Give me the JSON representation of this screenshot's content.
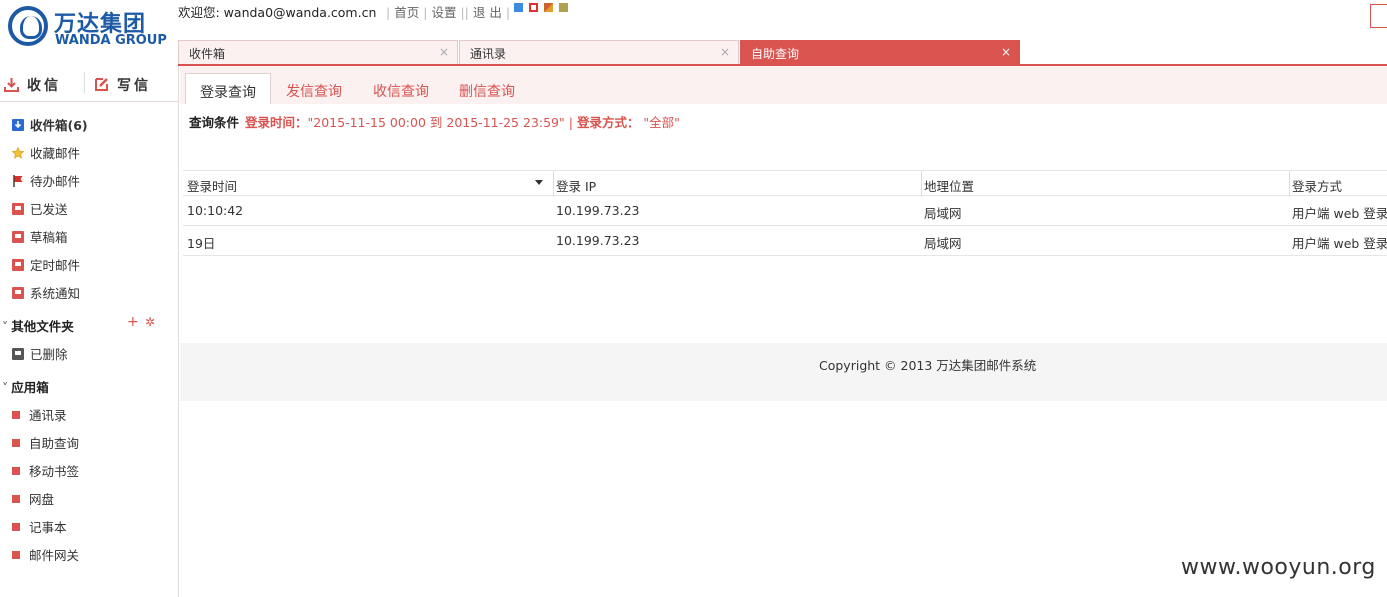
{
  "brand": {
    "name_cn": "万达集团",
    "name_en": "WANDA GROUP"
  },
  "header": {
    "welcome": "欢迎您: wanda0@wanda.com.cn",
    "links": [
      "首页",
      "设置",
      "退 出"
    ],
    "skins": [
      "#3b8be0",
      "#e03030",
      "#d06030",
      "#b0a050"
    ]
  },
  "tabs": [
    {
      "label": "收件箱",
      "close": "×"
    },
    {
      "label": "通讯录",
      "close": "×"
    },
    {
      "label": "自助查询",
      "close": "×"
    }
  ],
  "sidebar": {
    "receive": "收信",
    "write": "写信",
    "folders": [
      {
        "label": "收件箱(6)",
        "icon": "inbox-icon"
      },
      {
        "label": "收藏邮件",
        "icon": "star-icon"
      },
      {
        "label": "待办邮件",
        "icon": "flag-icon"
      },
      {
        "label": "已发送",
        "icon": "folder-icon"
      },
      {
        "label": "草稿箱",
        "icon": "folder-icon"
      },
      {
        "label": "定时邮件",
        "icon": "folder-icon"
      },
      {
        "label": "系统通知",
        "icon": "folder-icon"
      }
    ],
    "other_title": "其他文件夹",
    "other_items": [
      {
        "label": "已删除",
        "icon": "folder-icon"
      }
    ],
    "apps_title": "应用箱",
    "apps": [
      "通讯录",
      "自助查询",
      "移动书签",
      "网盘",
      "记事本",
      "邮件网关"
    ]
  },
  "subtabs": [
    "登录查询",
    "发信查询",
    "收信查询",
    "删信查询"
  ],
  "query": {
    "label": "查询条件",
    "time_label": "登录时间：",
    "time_value": "\"2015-11-15 00:00 到 2015-11-25 23:59\"",
    "sep": " | ",
    "method_label": "登录方式：",
    "method_value": " \"全部\""
  },
  "table": {
    "headers": [
      "登录时间",
      "登录 IP",
      "地理位置",
      "登录方式"
    ],
    "rows": [
      [
        "10:10:42",
        "10.199.73.23",
        "局域网",
        "用户端 web 登录"
      ],
      [
        "19日",
        "10.199.73.23",
        "局域网",
        "用户端 web 登录"
      ]
    ]
  },
  "footer": {
    "copyright": "Copyright © 2013 万达集团邮件系统"
  },
  "watermark": "www.wooyun.org"
}
